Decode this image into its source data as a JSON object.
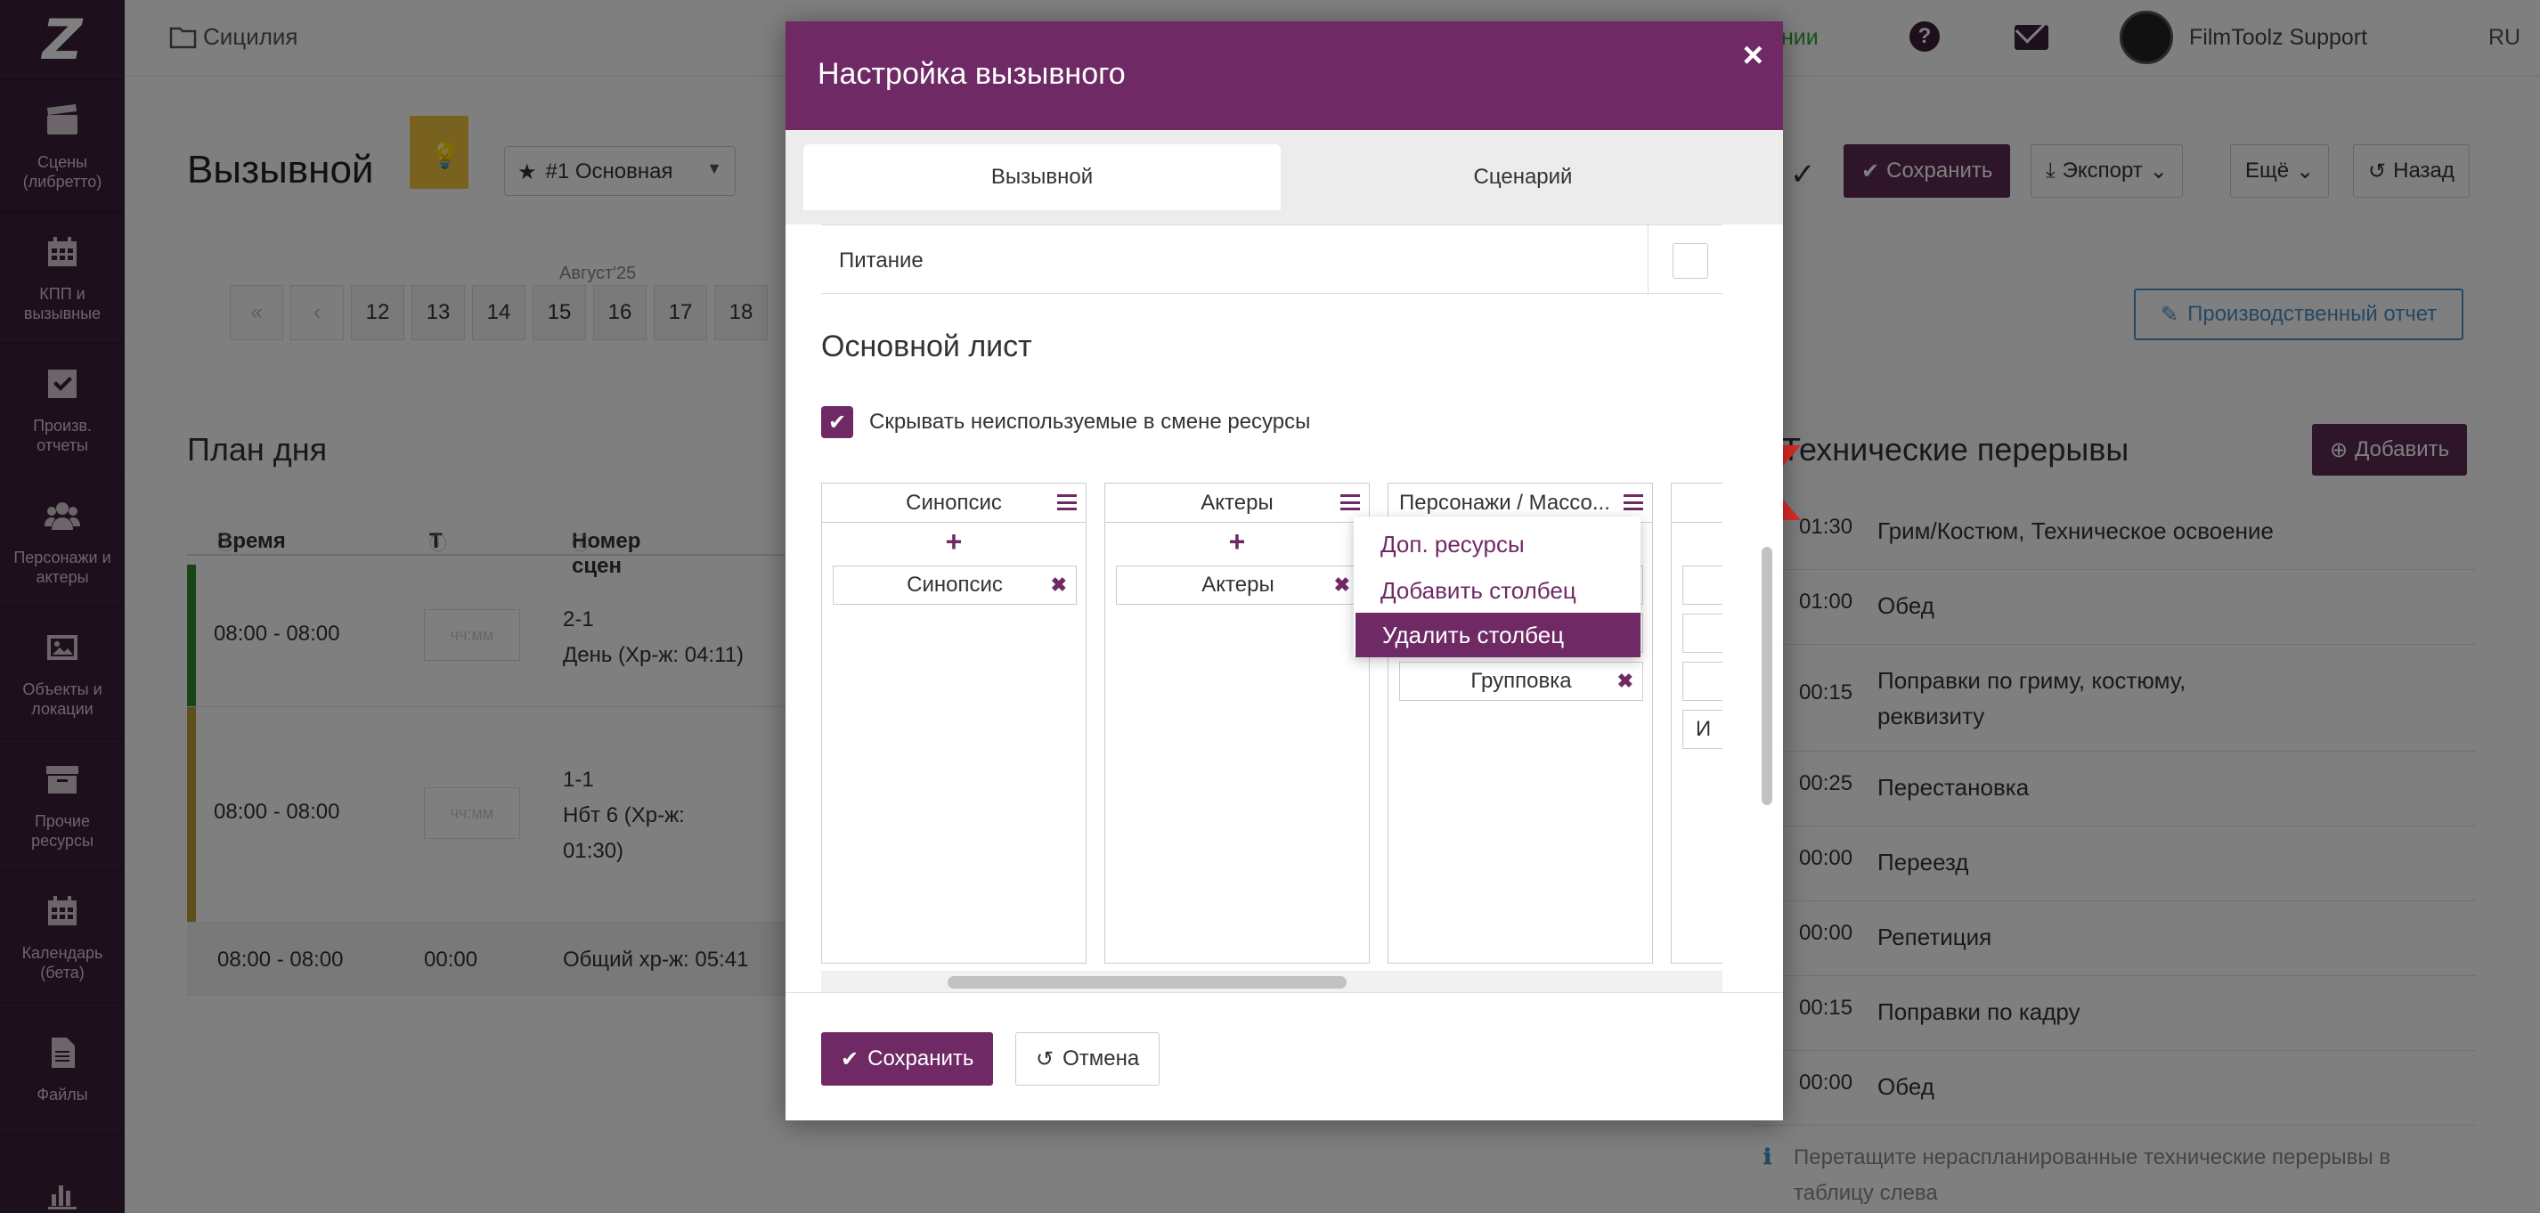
{
  "sidebar": {
    "logo": "Z",
    "items": [
      {
        "label": "Сцены (либретто)",
        "icon": "clapperboard-icon"
      },
      {
        "label": "КПП и вызывные",
        "icon": "calendar-grid-icon"
      },
      {
        "label": "Произв. отчеты",
        "icon": "checkbox-icon"
      },
      {
        "label": "Персонажи и актеры",
        "icon": "users-icon"
      },
      {
        "label": "Объекты и локации",
        "icon": "image-icon"
      },
      {
        "label": "Прочие ресурсы",
        "icon": "archive-icon"
      },
      {
        "label": "Календарь (бета)",
        "icon": "calendar-icon"
      },
      {
        "label": "Файлы",
        "icon": "file-icon"
      },
      {
        "label": "",
        "icon": "bar-chart-icon"
      }
    ]
  },
  "topbar": {
    "breadcrumb": "Сицилия",
    "green_text": "нии",
    "user": "FilmToolz Support",
    "lang": "RU"
  },
  "page": {
    "title": "Вызывной",
    "variant": "#1 Основная",
    "month": "Август'25",
    "pager": [
      "«",
      "‹",
      "12",
      "13",
      "14",
      "15",
      "16",
      "17",
      "18"
    ],
    "buttons": {
      "save": "Сохранить",
      "export": "Экспорт",
      "more": "Ещё",
      "back": "Назад",
      "prod_report": "Производственный отчет",
      "add": "Добавить"
    }
  },
  "plan": {
    "title": "План дня",
    "headers": {
      "time": "Время",
      "t": "Т",
      "scenes": "Номер сцен"
    },
    "rows": [
      {
        "time": "08:00 - 08:00",
        "input": "чч:мм",
        "scene": "2-1",
        "scene2": "День (Хр-ж: 04:11)"
      },
      {
        "time": "08:00 - 08:00",
        "input": "чч:мм",
        "scene": "1-1",
        "scene2": "Нбт 6 (Хр-ж:",
        "scene3": "01:30)"
      },
      {
        "time": "08:00 - 08:00",
        "t": "00:00",
        "scene": "Общий хр-ж: 05:41"
      }
    ]
  },
  "tech": {
    "title": "Технические перерывы",
    "rows": [
      {
        "d": "01:30",
        "n": "Грим/Костюм, Техническое освоение"
      },
      {
        "d": "01:00",
        "n": "Обед"
      },
      {
        "d": "00:15",
        "n": "Поправки по гриму, костюму,",
        "n2": "реквизиту"
      },
      {
        "d": "00:25",
        "n": "Перестановка"
      },
      {
        "d": "00:00",
        "n": "Переезд"
      },
      {
        "d": "00:00",
        "n": "Репетиция"
      },
      {
        "d": "00:15",
        "n": "Поправки по кадру"
      },
      {
        "d": "00:00",
        "n": "Обед"
      }
    ],
    "hint": "Перетащите нераспланированные технические перерывы в таблицу слева"
  },
  "modal": {
    "title": "Настройка вызывного",
    "close": "×",
    "tabs": [
      "Вызывной",
      "Сценарий"
    ],
    "food_label": "Питание",
    "section_title": "Основной лист",
    "hide_unused": "Скрывать неиспользуемые в смене ресурсы",
    "columns": [
      {
        "header": "Синопсис",
        "chips": [
          "Синопсис"
        ]
      },
      {
        "header": "Актеры",
        "chips": [
          "Актеры"
        ]
      },
      {
        "header": "Персонажи / Массо...",
        "chips": [
          "Групповка"
        ]
      },
      {
        "header": "",
        "chips": [
          "",
          "",
          "",
          "И"
        ]
      }
    ],
    "context_menu": [
      "Доп. ресурсы",
      "Добавить столбец",
      "Удалить столбец"
    ],
    "save": "Сохранить",
    "cancel": "Отмена"
  },
  "colors": {
    "brand": "#6f2a66",
    "sidebar": "#3a1f36",
    "annotation_red": "#e12a2a",
    "link_blue": "#4a90c8",
    "green": "#35a13a"
  }
}
